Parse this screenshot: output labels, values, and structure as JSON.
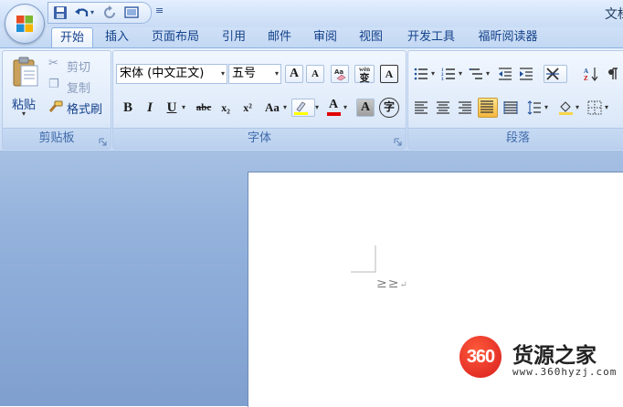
{
  "window": {
    "title": "文档"
  },
  "tabs": [
    "开始",
    "插入",
    "页面布局",
    "引用",
    "邮件",
    "审阅",
    "视图",
    "开发工具",
    "福昕阅读器"
  ],
  "active_tab": "开始",
  "clipboard": {
    "paste_label": "粘贴",
    "cut_label": "剪切",
    "copy_label": "复制",
    "format_painter_label": "格式刷",
    "group_label": "剪贴板"
  },
  "font": {
    "font_name": "宋体 (中文正文)",
    "font_size": "五号",
    "group_label": "字体",
    "grow_glyph": "A",
    "shrink_glyph": "A",
    "phonetic_glyph": "wén",
    "phonetic_char": "变",
    "border_char": "A",
    "bold": "B",
    "italic": "I",
    "underline": "U",
    "strike": "abc",
    "subscript": "x₂",
    "superscript": "x²",
    "case": "Aa",
    "font_color_glyph": "A",
    "shading_glyph": "A",
    "enclose_char": "字"
  },
  "paragraph": {
    "group_label": "段落"
  },
  "document": {
    "text": "≥≥",
    "paragraph_mark": "↵"
  },
  "watermark": {
    "badge": "360",
    "name": "货源之家",
    "url": "www.360hyzj.com"
  },
  "colors": {
    "ribbon_bg": "#dbe7f9",
    "accent_text": "#15428b",
    "highlight_yellow": "#ffff00",
    "font_red": "#e00000",
    "badge_red": "#d71e1e"
  }
}
